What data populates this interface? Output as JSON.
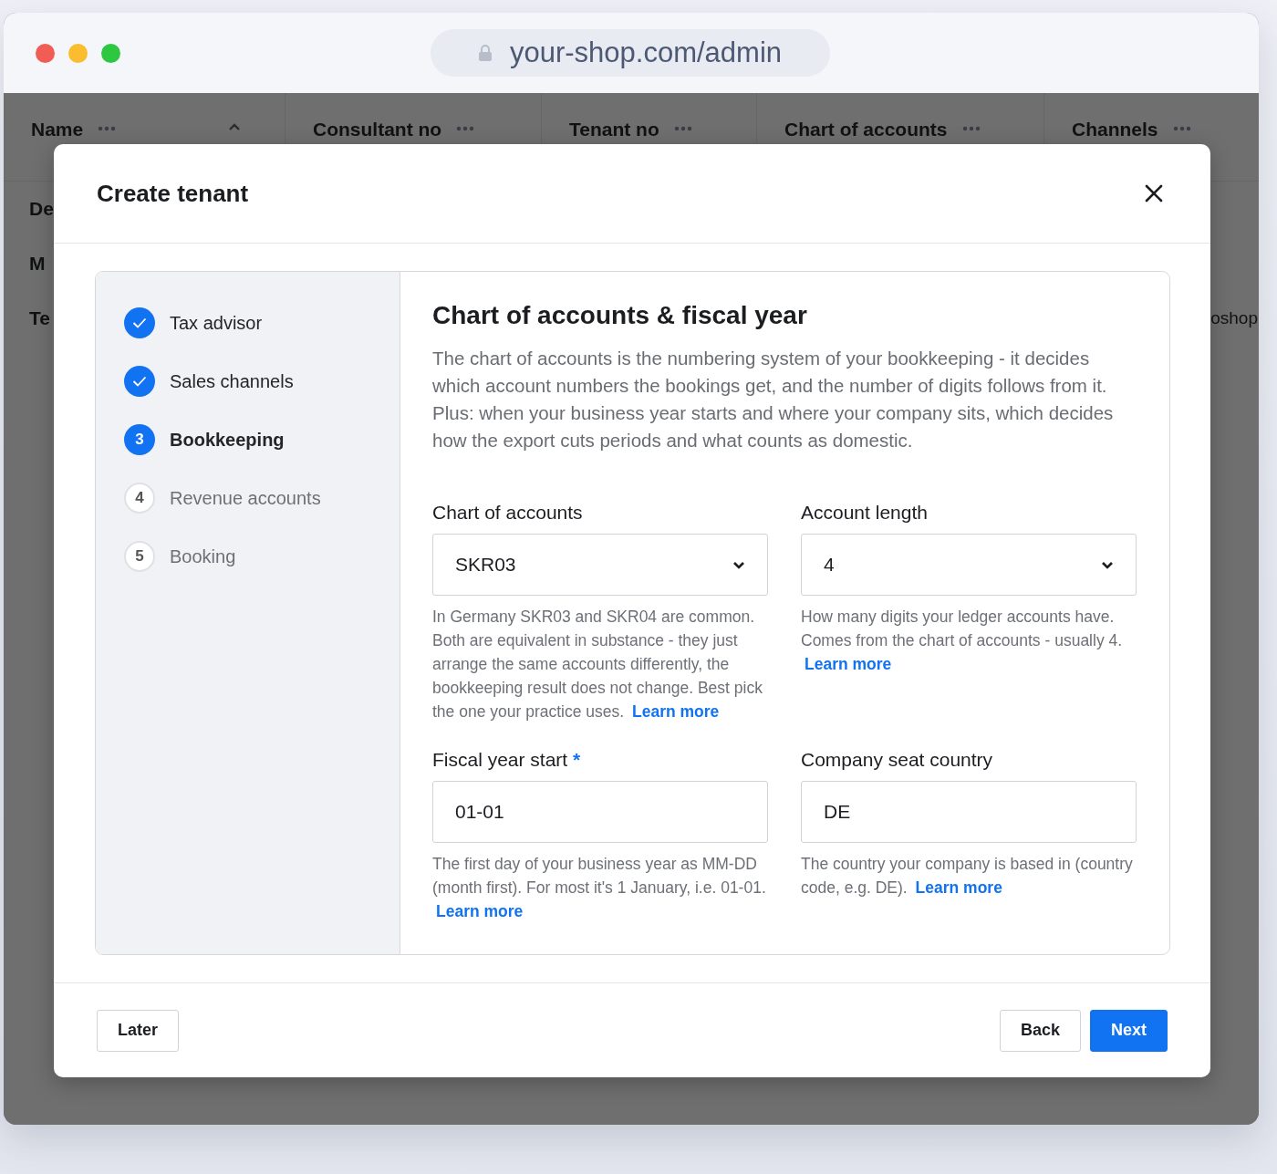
{
  "browser": {
    "url": "your-shop.com/admin"
  },
  "background_table": {
    "columns": [
      {
        "label": "Name",
        "sortable": true
      },
      {
        "label": "Consultant no",
        "sortable": false
      },
      {
        "label": "Tenant no",
        "sortable": false
      },
      {
        "label": "Chart of accounts",
        "sortable": false
      },
      {
        "label": "Channels",
        "sortable": false
      }
    ],
    "rows": [
      {
        "name": "De"
      },
      {
        "name": "M"
      },
      {
        "name": "Te",
        "channels": "oshop"
      }
    ]
  },
  "modal": {
    "title": "Create tenant",
    "steps": [
      {
        "label": "Tax advisor",
        "done": true,
        "selected": false
      },
      {
        "label": "Sales channels",
        "done": true,
        "selected": false
      },
      {
        "number": "3",
        "label": "Bookkeeping",
        "done": false,
        "selected": true
      },
      {
        "number": "4",
        "label": "Revenue accounts",
        "done": false,
        "selected": false
      },
      {
        "number": "5",
        "label": "Booking",
        "done": false,
        "selected": false
      }
    ],
    "heading": "Chart of accounts & fiscal year",
    "description": "The chart of accounts is the numbering system of your bookkeeping - it decides which account numbers the bookings get, and the number of digits follows from it. Plus: when your business year starts and where your company sits, which decides how the export cuts periods and what counts as domestic.",
    "fields": [
      {
        "kind": "select",
        "label": "Chart of accounts",
        "value": "SKR03",
        "help": "In Germany SKR03 and SKR04 are common. Both are equivalent in substance - they just arrange the same accounts differently, the bookkeeping result does not change. Best pick the one your practice uses.",
        "link": "Learn more"
      },
      {
        "kind": "select",
        "label": "Account length",
        "value": "4",
        "help": "How many digits your ledger accounts have. Comes from the chart of accounts - usually 4.",
        "link": "Learn more"
      },
      {
        "kind": "text",
        "label": "Fiscal year start",
        "required_mark": "*",
        "value": "01-01",
        "help": "The first day of your business year as MM-DD (month first). For most it's 1 January, i.e. 01-01.",
        "link": "Learn more"
      },
      {
        "kind": "text",
        "label": "Company seat country",
        "value": "DE",
        "help": "The country your company is based in (country code, e.g. DE).",
        "link": "Learn more"
      }
    ],
    "footer_left_buttons": [
      {
        "label": "Later",
        "kind": "secondary"
      }
    ],
    "footer_right_buttons": [
      {
        "label": "Back",
        "kind": "secondary"
      },
      {
        "label": "Next",
        "kind": "primary"
      }
    ]
  }
}
